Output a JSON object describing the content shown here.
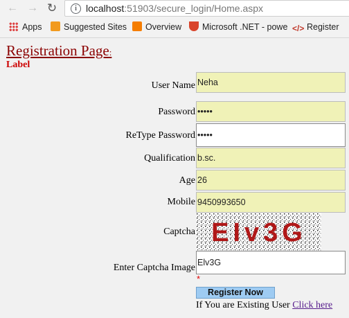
{
  "browser": {
    "url_host": "localhost",
    "url_path": ":51903/secure_login/Home.aspx",
    "bookmarks": [
      {
        "label": "Apps",
        "icon": "apps-grid-icon"
      },
      {
        "label": "Suggested Sites",
        "icon": "suggested-sites-icon"
      },
      {
        "label": "Overview",
        "icon": "blogger-icon"
      },
      {
        "label": "Microsoft .NET - powe",
        "icon": "dotnet-icon"
      },
      {
        "label": "Register",
        "icon": "code-icon"
      }
    ]
  },
  "page": {
    "title": "Registration Page",
    "title_suffix": ":",
    "label": "Label"
  },
  "form": {
    "username": {
      "label": "User Name",
      "value": "Neha"
    },
    "password": {
      "label": "Password",
      "value": "•••••"
    },
    "retype_password": {
      "label": "ReType Password",
      "value": "•••••"
    },
    "qualification": {
      "label": "Qualification",
      "value": "b.sc."
    },
    "age": {
      "label": "Age",
      "value": "26"
    },
    "mobile": {
      "label": "Mobile",
      "value": "9450993650"
    },
    "captcha": {
      "label": "Captcha",
      "text": "EIv3G"
    },
    "enter_captcha": {
      "label": "Enter Captcha Image",
      "value": "Elv3G",
      "required_mark": "*"
    },
    "submit_label": "Register Now",
    "existing_text": "If You are Existing User ",
    "existing_link": "Click here"
  },
  "colors": {
    "title": "#8b0000",
    "label": "#cc0000",
    "input_bg": "#f0f2b7",
    "button_bg": "#9ecbf2",
    "link": "#551a8b"
  }
}
